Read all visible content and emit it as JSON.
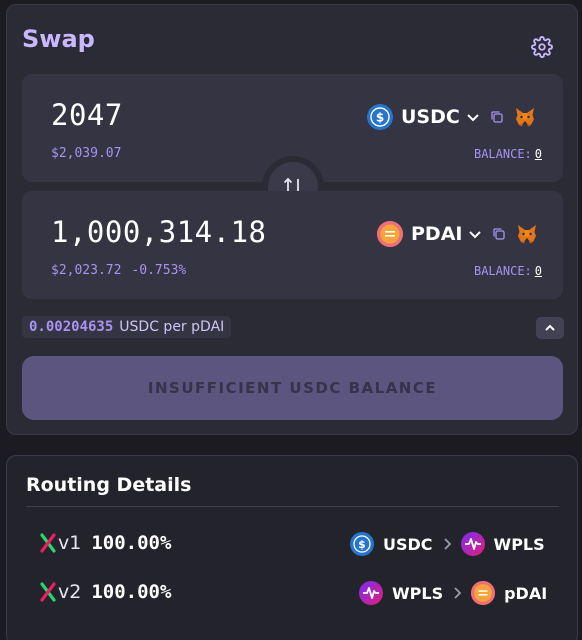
{
  "swap": {
    "title": "Swap",
    "from": {
      "amount": "2047",
      "usd_value": "$2,039.07",
      "token": "USDC",
      "balance_label": "BALANCE:",
      "balance_value": "0"
    },
    "to": {
      "amount": "1,000,314.18",
      "usd_value": "$2,023.72",
      "price_impact": "-0.753%",
      "token": "PDAI",
      "balance_label": "BALANCE:",
      "balance_value": "0"
    },
    "rate": {
      "value": "0.00204635",
      "unit": "USDC per pDAI"
    },
    "action_label": "INSUFFICIENT USDC BALANCE"
  },
  "routing": {
    "title": "Routing Details",
    "routes": [
      {
        "version": "v1",
        "percent": "100.00%",
        "path": [
          "USDC",
          "WPLS"
        ]
      },
      {
        "version": "v2",
        "percent": "100.00%",
        "path": [
          "WPLS",
          "pDAI"
        ]
      }
    ]
  },
  "colors": {
    "accent": "#a893f0",
    "title": "#c9b8ff",
    "usdc": "#2775ca",
    "pdai": "#f7a43b",
    "wpls": "#e0207a",
    "button_disabled": "#5b557f"
  },
  "icons": {
    "settings": "gear-icon",
    "switch": "swap-arrows-icon",
    "copy": "copy-icon",
    "wallet": "metamask-fox-icon",
    "dropdown": "chevron-down-icon",
    "expand": "chevron-up-icon",
    "route_separator": "chevron-right-icon",
    "dex_logo": "pulsex-icon"
  }
}
